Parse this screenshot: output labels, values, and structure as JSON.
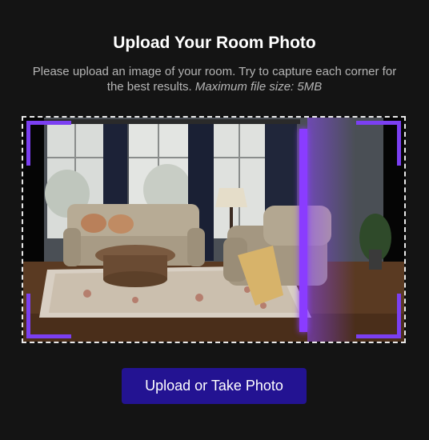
{
  "header": {
    "title": "Upload Your Room Photo",
    "subtitle_main": "Please upload an image of your room. Try to capture each corner for the best results.",
    "subtitle_note": "Maximum file size: 5MB"
  },
  "dropzone": {
    "image_alt": "Living room photo with reclining sofas",
    "scanner_color": "#8a3cff",
    "corner_color": "#7b3ff2"
  },
  "actions": {
    "upload_label": "Upload or Take Photo",
    "button_color": "#231392"
  }
}
